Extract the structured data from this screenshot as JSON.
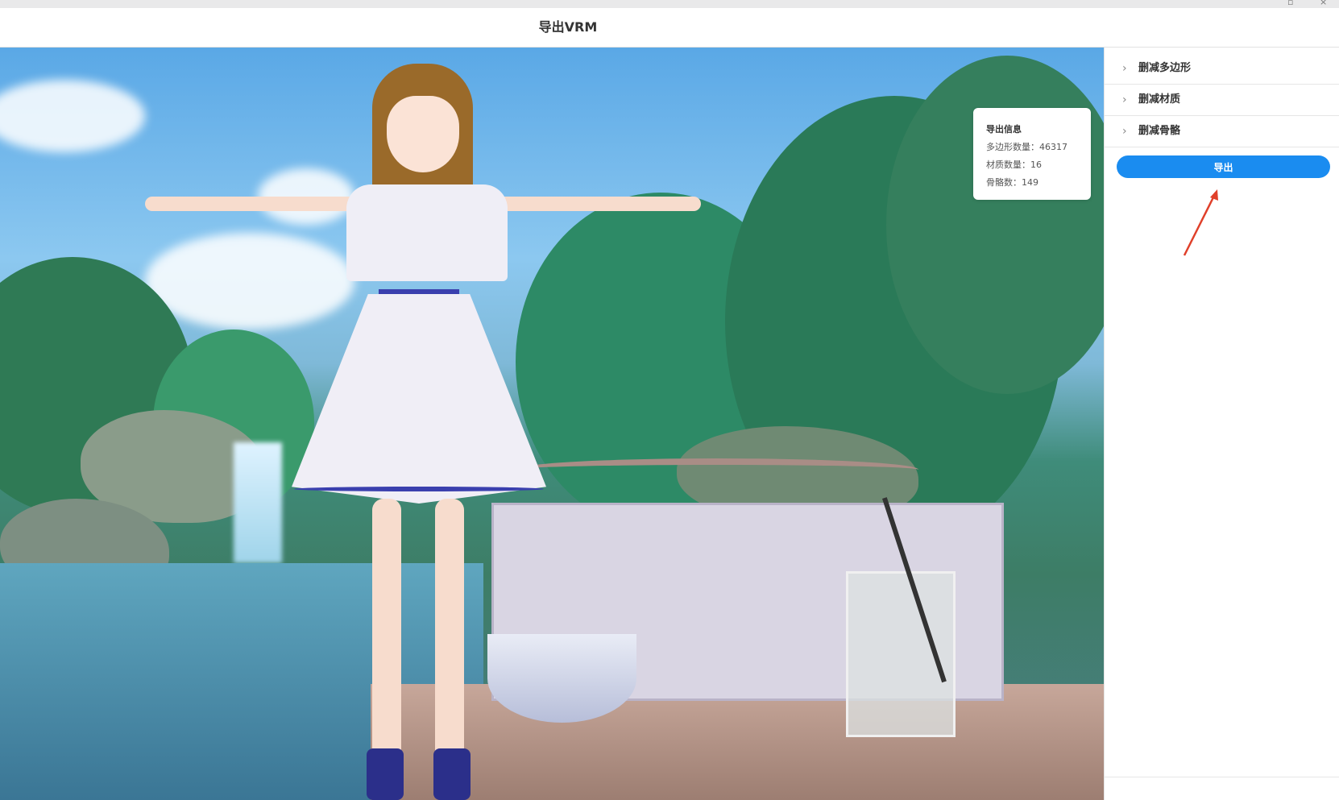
{
  "window": {
    "title": "导出VRM"
  },
  "info_card": {
    "title": "导出信息",
    "polygons": "多边形数量：46317",
    "materials": "材质数量：16",
    "bones": "骨骼数：149"
  },
  "panel": {
    "items": [
      {
        "label": "删减多边形",
        "icon": "chevron-right-icon"
      },
      {
        "label": "删减材质",
        "icon": "chevron-right-icon"
      },
      {
        "label": "删减骨骼",
        "icon": "chevron-right-icon"
      }
    ],
    "export_label": "导出"
  },
  "colors": {
    "accent": "#1a8cf0",
    "annotation_arrow": "#e0402a"
  }
}
